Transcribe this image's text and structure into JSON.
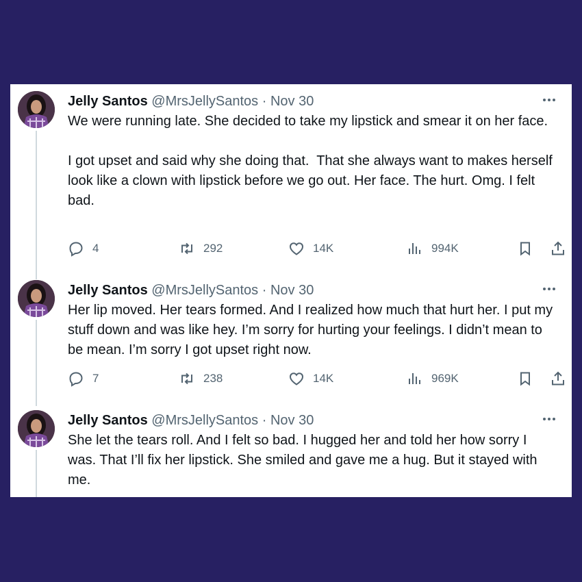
{
  "colors": {
    "background": "#272062",
    "card": "#ffffff",
    "text": "#0f1419",
    "muted": "#536471",
    "thread_line": "#cfd9de"
  },
  "icons": [
    "reply-icon",
    "retweet-icon",
    "like-icon",
    "views-icon",
    "bookmark-icon",
    "share-icon",
    "more-icon"
  ],
  "tweets": [
    {
      "name": "Jelly Santos",
      "handle": "@MrsJellySantos",
      "separator": "·",
      "date": "Nov 30",
      "text": "We were running late. She decided to take my lipstick and smear it on her face.\n\nI got upset and said why she doing that.  That she always want to makes herself look like a clown with lipstick before we go out. Her face. The hurt. Omg. I felt bad.",
      "replies": "4",
      "reposts": "292",
      "likes": "14K",
      "views": "994K"
    },
    {
      "name": "Jelly Santos",
      "handle": "@MrsJellySantos",
      "separator": "·",
      "date": "Nov 30",
      "text": "Her lip moved. Her tears formed. And I realized how much that hurt her. I put my stuff down and was like hey. I’m sorry for hurting your feelings. I didn’t mean to be mean. I’m sorry I got upset right now.",
      "replies": "7",
      "reposts": "238",
      "likes": "14K",
      "views": "969K"
    },
    {
      "name": "Jelly Santos",
      "handle": "@MrsJellySantos",
      "separator": "·",
      "date": "Nov 30",
      "text": "She let the tears roll. And I felt so bad. I hugged her and told her how sorry I was. That I’ll fix her lipstick. She smiled and gave me a hug. But it stayed with me."
    }
  ]
}
